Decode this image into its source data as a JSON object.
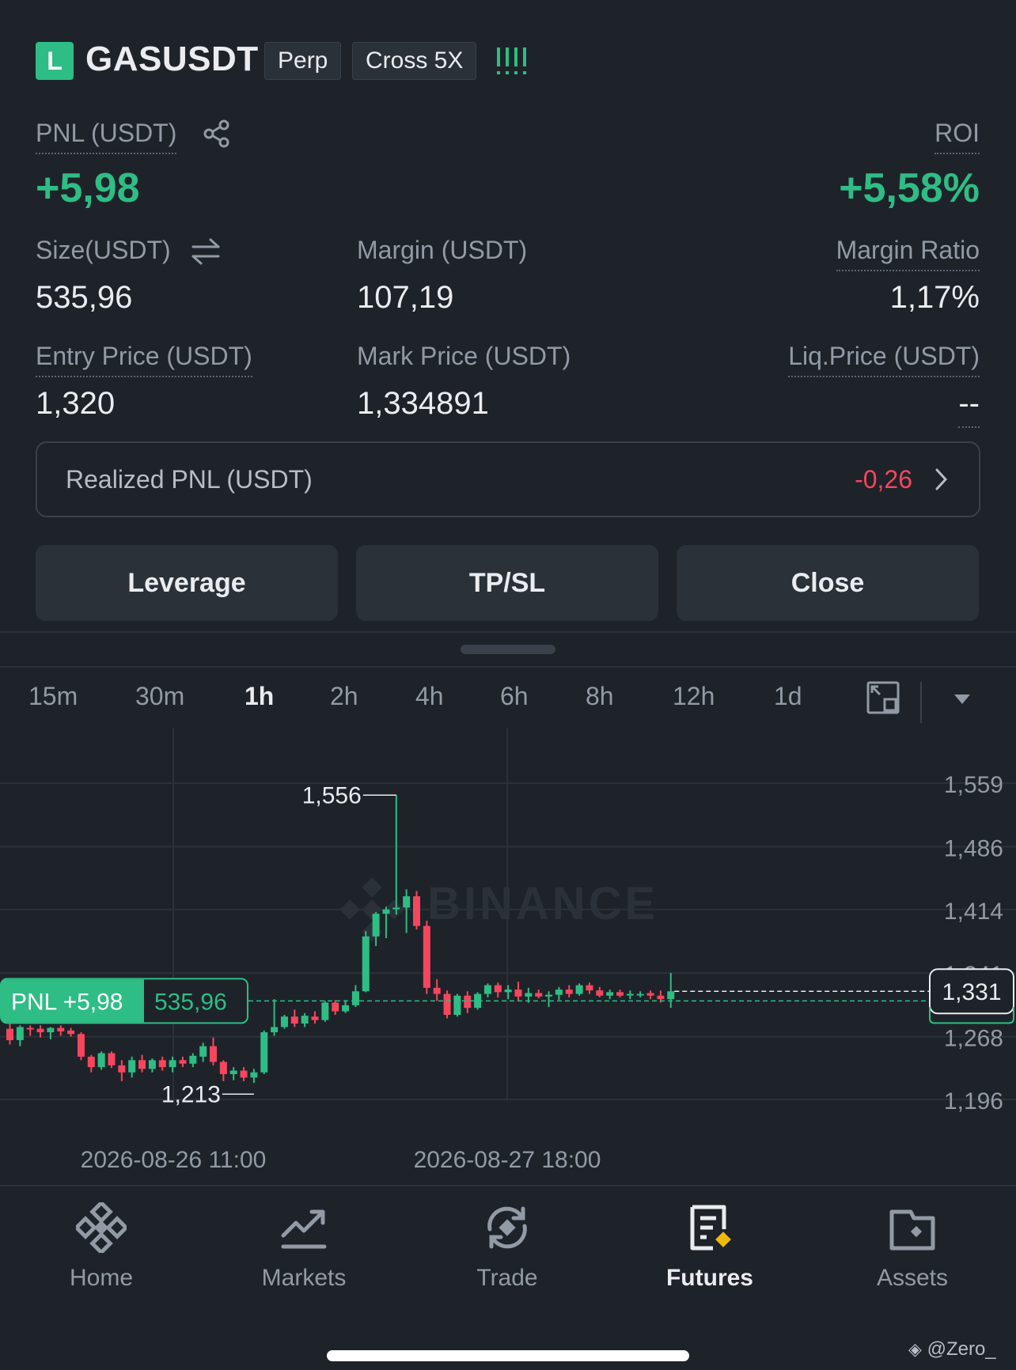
{
  "header": {
    "side_badge": "L",
    "symbol": "GASUSDT",
    "tags": [
      "Perp",
      "Cross 5X"
    ]
  },
  "pnl": {
    "label": "PNL (USDT)",
    "value": "+5,98"
  },
  "roi": {
    "label": "ROI",
    "value": "+5,58%"
  },
  "size": {
    "label": "Size(USDT)",
    "value": "535,96"
  },
  "margin": {
    "label": "Margin (USDT)",
    "value": "107,19"
  },
  "margin_ratio": {
    "label": "Margin Ratio",
    "value": "1,17%"
  },
  "entry_price": {
    "label": "Entry Price (USDT)",
    "value": "1,320"
  },
  "mark_price": {
    "label": "Mark Price (USDT)",
    "value": "1,334891"
  },
  "liq_price": {
    "label": "Liq.Price (USDT)",
    "value": "--"
  },
  "realized_pnl": {
    "label": "Realized PNL (USDT)",
    "value": "-0,26"
  },
  "buttons": {
    "leverage": "Leverage",
    "tpsl": "TP/SL",
    "close": "Close"
  },
  "timeframes": [
    "15m",
    "30m",
    "1h",
    "2h",
    "4h",
    "6h",
    "8h",
    "12h",
    "1d"
  ],
  "active_timeframe": "1h",
  "chart": {
    "watermark": "BINANCE",
    "y_ticks": [
      "1,559",
      "1,486",
      "1,414",
      "1,341",
      "1,268",
      "1,196"
    ],
    "x_ticks": [
      "2026-08-26 11:00",
      "2026-08-27 18:00"
    ],
    "high_label": "1,556",
    "low_label": "1,213",
    "last_price": "1,331",
    "position_pnl_label": "PNL +5,98",
    "position_size_label": "535,96"
  },
  "nav": {
    "home": "Home",
    "markets": "Markets",
    "trade": "Trade",
    "futures": "Futures",
    "assets": "Assets"
  },
  "watermark_text": "@Zero_",
  "colors": {
    "up": "#2ebd85",
    "down": "#f6465d",
    "accent": "#f0b90b",
    "bg": "#1e2329"
  },
  "chart_data": {
    "type": "candlestick",
    "y_ticks": [
      1.559,
      1.486,
      1.414,
      1.341,
      1.268,
      1.196
    ],
    "ylim": [
      1.196,
      1.559
    ],
    "entry_price": 1.32,
    "last_price": 1.331,
    "high": 1.556,
    "low": 1.213,
    "candles": [
      {
        "o": 1.288,
        "h": 1.298,
        "l": 1.27,
        "c": 1.275
      },
      {
        "o": 1.275,
        "h": 1.292,
        "l": 1.268,
        "c": 1.29
      },
      {
        "o": 1.289,
        "h": 1.292,
        "l": 1.28,
        "c": 1.288
      },
      {
        "o": 1.288,
        "h": 1.292,
        "l": 1.278,
        "c": 1.284
      },
      {
        "o": 1.284,
        "h": 1.29,
        "l": 1.276,
        "c": 1.289
      },
      {
        "o": 1.289,
        "h": 1.292,
        "l": 1.28,
        "c": 1.285
      },
      {
        "o": 1.286,
        "h": 1.289,
        "l": 1.279,
        "c": 1.282
      },
      {
        "o": 1.282,
        "h": 1.284,
        "l": 1.252,
        "c": 1.256
      },
      {
        "o": 1.256,
        "h": 1.258,
        "l": 1.238,
        "c": 1.244
      },
      {
        "o": 1.244,
        "h": 1.262,
        "l": 1.241,
        "c": 1.26
      },
      {
        "o": 1.26,
        "h": 1.262,
        "l": 1.243,
        "c": 1.246
      },
      {
        "o": 1.246,
        "h": 1.252,
        "l": 1.228,
        "c": 1.238
      },
      {
        "o": 1.238,
        "h": 1.256,
        "l": 1.232,
        "c": 1.252
      },
      {
        "o": 1.252,
        "h": 1.258,
        "l": 1.238,
        "c": 1.242
      },
      {
        "o": 1.242,
        "h": 1.254,
        "l": 1.238,
        "c": 1.252
      },
      {
        "o": 1.252,
        "h": 1.256,
        "l": 1.24,
        "c": 1.244
      },
      {
        "o": 1.244,
        "h": 1.256,
        "l": 1.238,
        "c": 1.252
      },
      {
        "o": 1.252,
        "h": 1.256,
        "l": 1.244,
        "c": 1.248
      },
      {
        "o": 1.248,
        "h": 1.26,
        "l": 1.244,
        "c": 1.257
      },
      {
        "o": 1.256,
        "h": 1.272,
        "l": 1.25,
        "c": 1.268
      },
      {
        "o": 1.268,
        "h": 1.278,
        "l": 1.246,
        "c": 1.25
      },
      {
        "o": 1.25,
        "h": 1.252,
        "l": 1.228,
        "c": 1.236
      },
      {
        "o": 1.236,
        "h": 1.244,
        "l": 1.229,
        "c": 1.24
      },
      {
        "o": 1.24,
        "h": 1.244,
        "l": 1.228,
        "c": 1.232
      },
      {
        "o": 1.232,
        "h": 1.242,
        "l": 1.226,
        "c": 1.238
      },
      {
        "o": 1.238,
        "h": 1.286,
        "l": 1.236,
        "c": 1.284
      },
      {
        "o": 1.284,
        "h": 1.322,
        "l": 1.28,
        "c": 1.29
      },
      {
        "o": 1.29,
        "h": 1.304,
        "l": 1.288,
        "c": 1.302
      },
      {
        "o": 1.302,
        "h": 1.31,
        "l": 1.29,
        "c": 1.294
      },
      {
        "o": 1.294,
        "h": 1.306,
        "l": 1.29,
        "c": 1.303
      },
      {
        "o": 1.302,
        "h": 1.308,
        "l": 1.294,
        "c": 1.298
      },
      {
        "o": 1.298,
        "h": 1.32,
        "l": 1.296,
        "c": 1.318
      },
      {
        "o": 1.318,
        "h": 1.321,
        "l": 1.304,
        "c": 1.308
      },
      {
        "o": 1.308,
        "h": 1.321,
        "l": 1.306,
        "c": 1.315
      },
      {
        "o": 1.315,
        "h": 1.338,
        "l": 1.313,
        "c": 1.331
      },
      {
        "o": 1.331,
        "h": 1.4,
        "l": 1.33,
        "c": 1.394
      },
      {
        "o": 1.394,
        "h": 1.422,
        "l": 1.383,
        "c": 1.42
      },
      {
        "o": 1.42,
        "h": 1.428,
        "l": 1.392,
        "c": 1.425
      },
      {
        "o": 1.425,
        "h": 1.556,
        "l": 1.419,
        "c": 1.427
      },
      {
        "o": 1.427,
        "h": 1.448,
        "l": 1.398,
        "c": 1.44
      },
      {
        "o": 1.44,
        "h": 1.446,
        "l": 1.402,
        "c": 1.406
      },
      {
        "o": 1.406,
        "h": 1.412,
        "l": 1.328,
        "c": 1.335
      },
      {
        "o": 1.335,
        "h": 1.345,
        "l": 1.32,
        "c": 1.328
      },
      {
        "o": 1.328,
        "h": 1.332,
        "l": 1.3,
        "c": 1.304
      },
      {
        "o": 1.304,
        "h": 1.328,
        "l": 1.302,
        "c": 1.326
      },
      {
        "o": 1.326,
        "h": 1.331,
        "l": 1.306,
        "c": 1.312
      },
      {
        "o": 1.312,
        "h": 1.33,
        "l": 1.31,
        "c": 1.328
      },
      {
        "o": 1.328,
        "h": 1.34,
        "l": 1.324,
        "c": 1.338
      },
      {
        "o": 1.338,
        "h": 1.341,
        "l": 1.324,
        "c": 1.33
      },
      {
        "o": 1.33,
        "h": 1.338,
        "l": 1.322,
        "c": 1.333
      },
      {
        "o": 1.333,
        "h": 1.342,
        "l": 1.32,
        "c": 1.325
      },
      {
        "o": 1.325,
        "h": 1.335,
        "l": 1.318,
        "c": 1.329
      },
      {
        "o": 1.329,
        "h": 1.333,
        "l": 1.323,
        "c": 1.325
      },
      {
        "o": 1.325,
        "h": 1.331,
        "l": 1.313,
        "c": 1.327
      },
      {
        "o": 1.327,
        "h": 1.336,
        "l": 1.321,
        "c": 1.333
      },
      {
        "o": 1.333,
        "h": 1.338,
        "l": 1.324,
        "c": 1.328
      },
      {
        "o": 1.328,
        "h": 1.34,
        "l": 1.326,
        "c": 1.338
      },
      {
        "o": 1.338,
        "h": 1.341,
        "l": 1.328,
        "c": 1.332
      },
      {
        "o": 1.332,
        "h": 1.336,
        "l": 1.324,
        "c": 1.326
      },
      {
        "o": 1.326,
        "h": 1.333,
        "l": 1.322,
        "c": 1.33
      },
      {
        "o": 1.33,
        "h": 1.333,
        "l": 1.324,
        "c": 1.326
      },
      {
        "o": 1.327,
        "h": 1.332,
        "l": 1.322,
        "c": 1.328
      },
      {
        "o": 1.328,
        "h": 1.331,
        "l": 1.324,
        "c": 1.328
      },
      {
        "o": 1.329,
        "h": 1.332,
        "l": 1.322,
        "c": 1.326
      },
      {
        "o": 1.326,
        "h": 1.332,
        "l": 1.318,
        "c": 1.322
      },
      {
        "o": 1.322,
        "h": 1.352,
        "l": 1.312,
        "c": 1.331
      }
    ]
  }
}
